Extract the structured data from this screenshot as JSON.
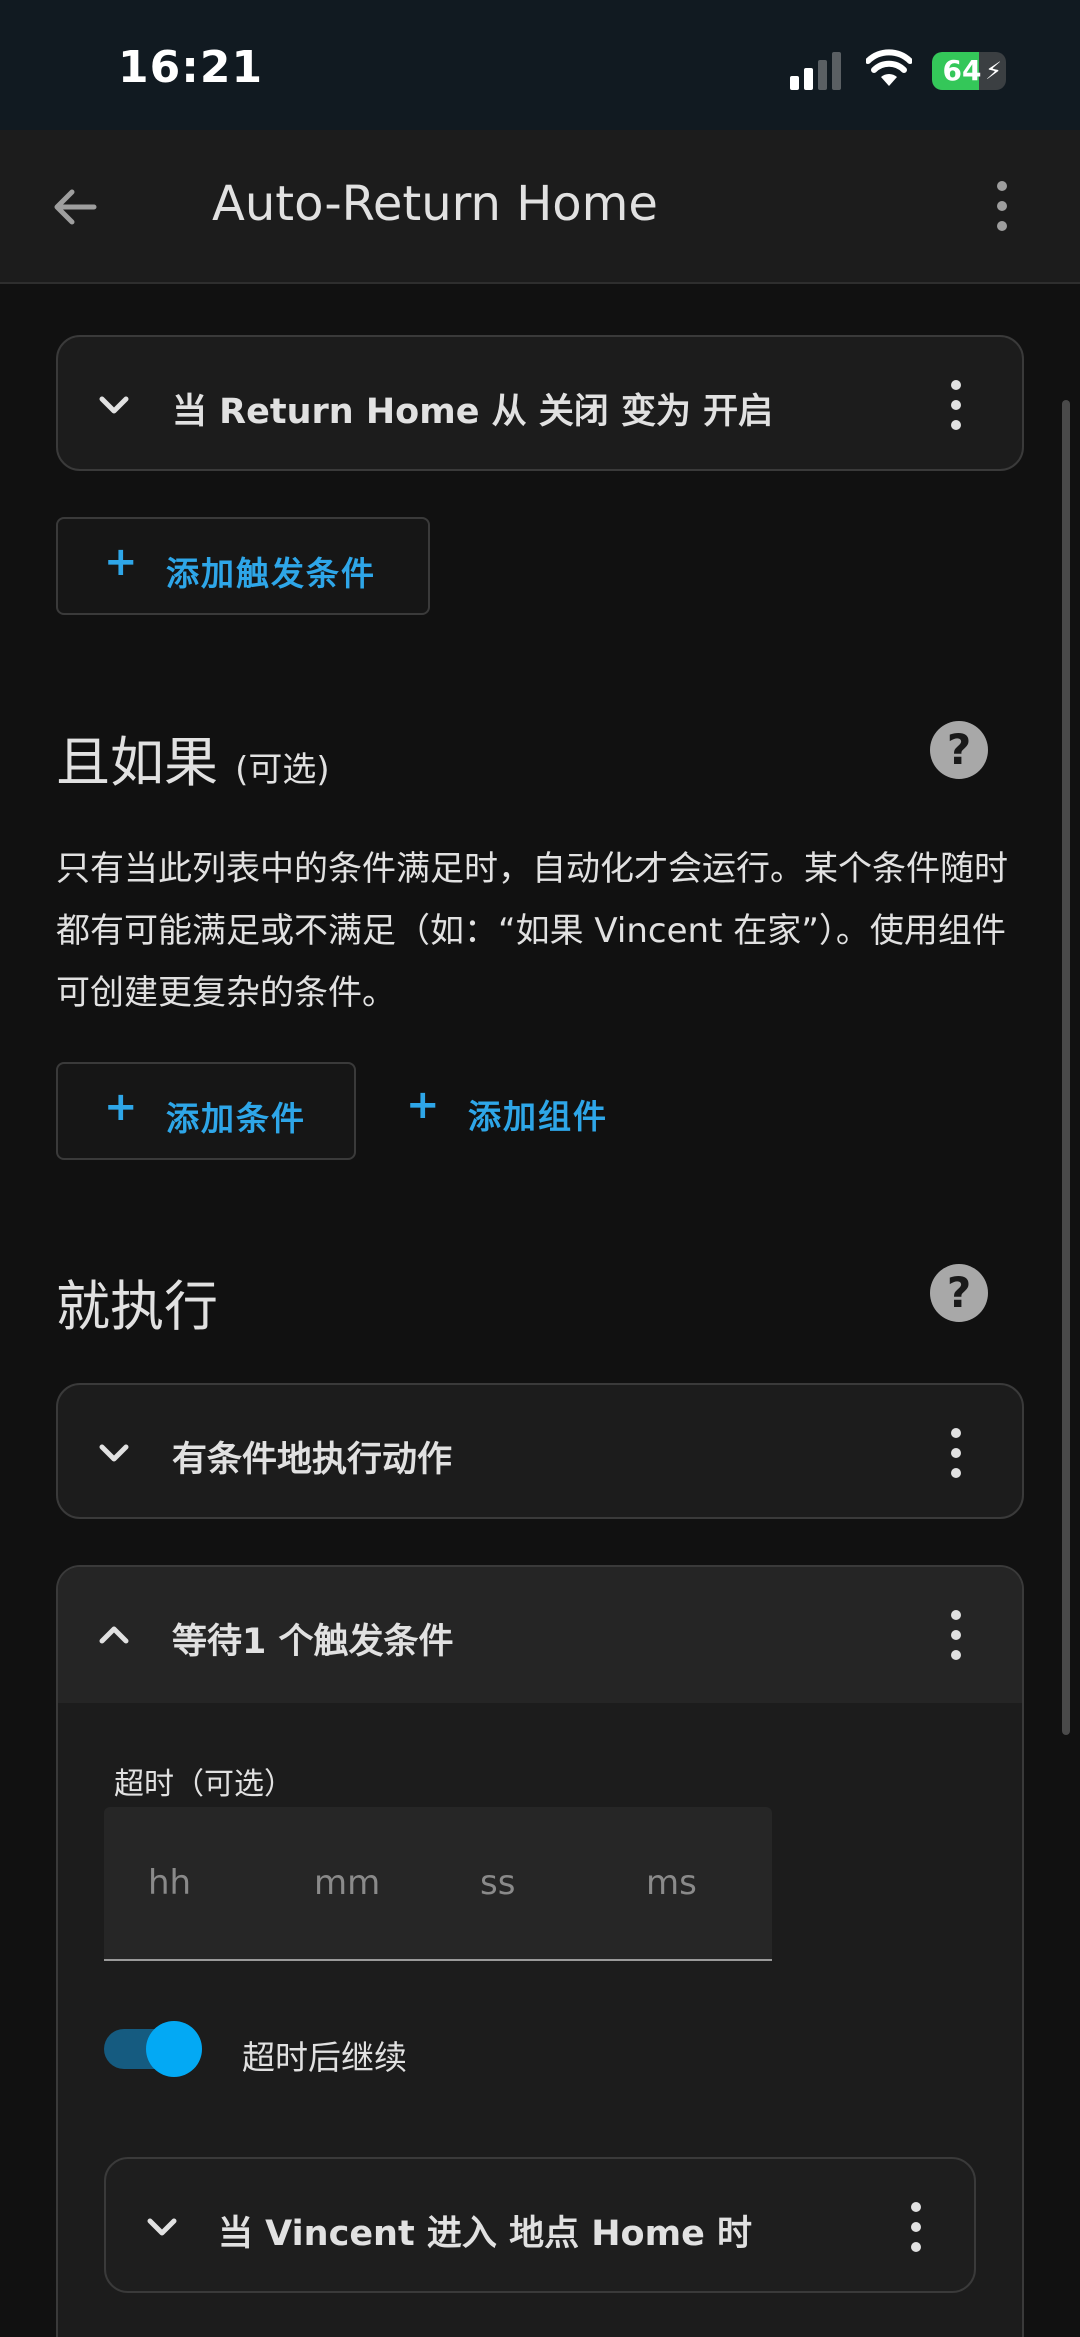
{
  "status_bar": {
    "time": "16:21",
    "battery_level": "64",
    "battery_fraction": 0.64,
    "battery_color": "#34c759"
  },
  "app_bar": {
    "title": "Auto-Return Home",
    "back_icon": "arrow-left-icon",
    "menu_icon": "dots-vertical-icon"
  },
  "triggers": {
    "items": [
      {
        "label": "当 Return Home 从 关闭 变为 开启",
        "expanded": false
      }
    ],
    "add_button": "添加触发条件"
  },
  "conditions": {
    "title": "且如果",
    "optional": "(可选)",
    "description": "只有当此列表中的条件满足时，自动化才会运行。某个条件随时都有可能满足或不满足（如：“如果 Vincent 在家”）。使用组件可创建更复杂的条件。",
    "add_condition": "添加条件",
    "add_building_block": "添加组件",
    "help_icon": "help-circle-icon"
  },
  "actions": {
    "title": "就执行",
    "help_icon": "help-circle-icon",
    "items": [
      {
        "label": "有条件地执行动作",
        "expanded": false
      },
      {
        "label": "等待1 个触发条件",
        "expanded": true
      }
    ],
    "wait_trigger": {
      "timeout_label": "超时（可选）",
      "duration_placeholders": {
        "hours": "hh",
        "minutes": "mm",
        "seconds": "ss",
        "milliseconds": "ms"
      },
      "continue_on_timeout_label": "超时后继续",
      "continue_on_timeout": true,
      "nested_trigger": {
        "label": "当 Vincent 进入 地点 Home 时",
        "expanded": false
      }
    }
  },
  "colors": {
    "accent": "#2ea6e8",
    "switch_on": "#03a9f4",
    "background": "#111111",
    "card": "#1c1c1c"
  }
}
